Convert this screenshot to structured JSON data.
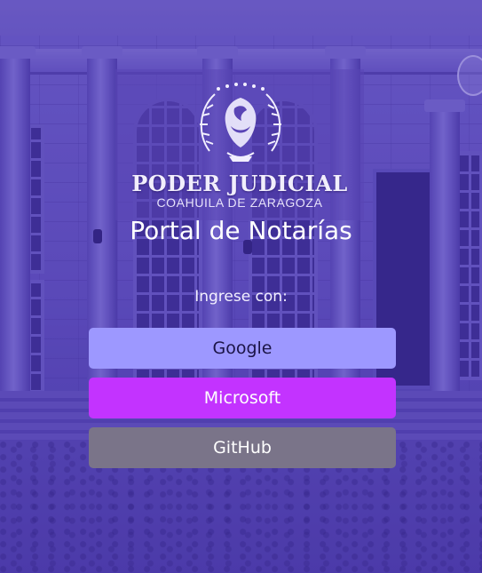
{
  "branding": {
    "institution": "PODER JUDICIAL",
    "state": "COAHUILA DE ZARAGOZA"
  },
  "page": {
    "title": "Portal de Notarías",
    "login_prompt": "Ingrese con:"
  },
  "auth_buttons": [
    {
      "label": "Google",
      "icon": "google",
      "color": "#9d98ff"
    },
    {
      "label": "Microsoft",
      "icon": "microsoft",
      "color": "#c333ff"
    },
    {
      "label": "GitHub",
      "icon": "github",
      "color": "#7a7489"
    }
  ],
  "theme": {
    "overlay_color": "#4c38be",
    "text_color": "#ffffff"
  }
}
